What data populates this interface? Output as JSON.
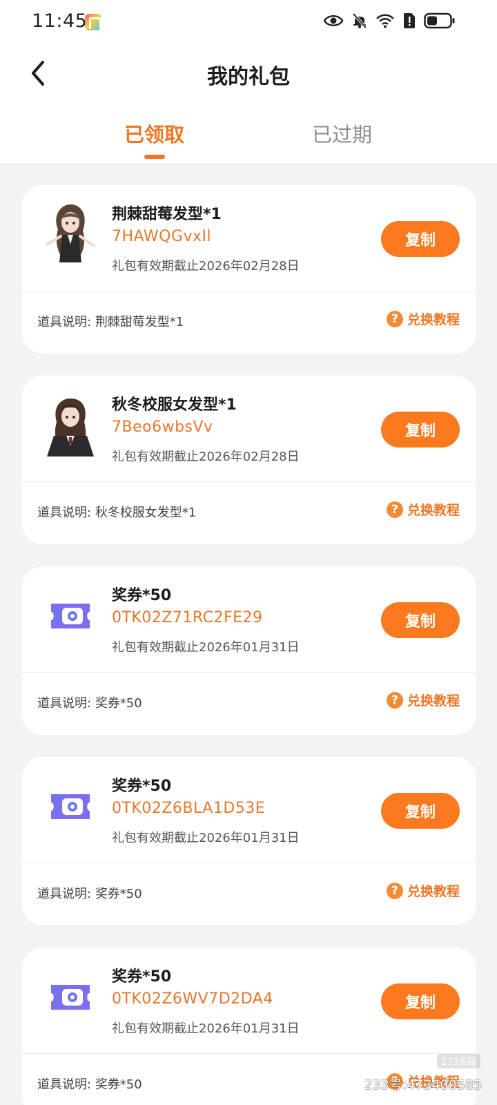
{
  "status_bar": {
    "time": "11:45"
  },
  "header": {
    "title": "我的礼包",
    "back_icon": "chevron-left-icon"
  },
  "tabs": [
    {
      "label": "已领取",
      "active": true
    },
    {
      "label": "已过期",
      "active": false
    }
  ],
  "colors": {
    "accent": "#f07624",
    "button": "#fb7a1f",
    "background": "#f3f3f4"
  },
  "gifts": [
    {
      "name": "荆棘甜莓发型*1",
      "code": "7HAWQGvxIl",
      "expiry": "礼包有效期截止2026年02月28日",
      "copy_label": "复制",
      "desc_label": "道具说明:",
      "desc_value": "荆棘甜莓发型*1",
      "tutorial_label": "兑换教程",
      "icon": "character-avatar-icon"
    },
    {
      "name": "秋冬校服女发型*1",
      "code": "7Beo6wbsVv",
      "expiry": "礼包有效期截止2026年02月28日",
      "copy_label": "复制",
      "desc_label": "道具说明:",
      "desc_value": "秋冬校服女发型*1",
      "tutorial_label": "兑换教程",
      "icon": "character-avatar-icon"
    },
    {
      "name": "奖券*50",
      "code": "0TK02Z71RC2FE29",
      "expiry": "礼包有效期截止2026年01月31日",
      "copy_label": "复制",
      "desc_label": "道具说明:",
      "desc_value": "奖券*50",
      "tutorial_label": "兑换教程",
      "icon": "ticket-icon"
    },
    {
      "name": "奖券*50",
      "code": "0TK02Z6BLA1D53E",
      "expiry": "礼包有效期截止2026年01月31日",
      "copy_label": "复制",
      "desc_label": "道具说明:",
      "desc_value": "奖券*50",
      "tutorial_label": "兑换教程",
      "icon": "ticket-icon"
    },
    {
      "name": "奖券*50",
      "code": "0TK02Z6WV7D2DA4",
      "expiry": "礼包有效期截止2026年01月31日",
      "copy_label": "复制",
      "desc_label": "道具说明:",
      "desc_value": "奖券*50",
      "tutorial_label": "兑换教程",
      "icon": "ticket-icon"
    }
  ],
  "watermark": {
    "brand": "233乐园",
    "account": "233号:473400585"
  }
}
